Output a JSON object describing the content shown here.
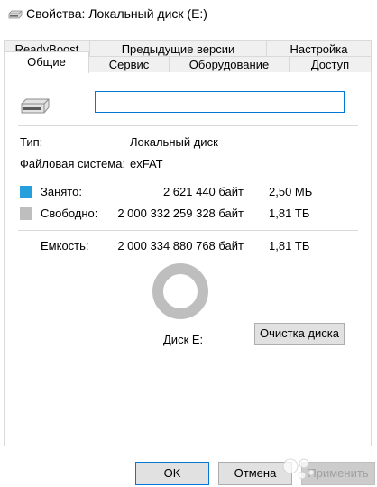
{
  "window": {
    "title": "Свойства: Локальный диск (E:)"
  },
  "tabs": {
    "row1": [
      "ReadyBoost",
      "Предыдущие версии",
      "Настройка"
    ],
    "row2": [
      "Общие",
      "Сервис",
      "Оборудование",
      "Доступ"
    ],
    "active": "Общие"
  },
  "general": {
    "name_value": "",
    "type_label": "Тип:",
    "type_value": "Локальный диск",
    "fs_label": "Файловая система:",
    "fs_value": "exFAT",
    "used_label": "Занято:",
    "used_bytes": "2 621 440 байт",
    "used_size": "2,50 МБ",
    "free_label": "Свободно:",
    "free_bytes": "2 000 332 259 328 байт",
    "free_size": "1,81 ТБ",
    "capacity_label": "Емкость:",
    "capacity_bytes": "2 000 334 880 768 байт",
    "capacity_size": "1,81 ТБ",
    "disk_label": "Диск E:",
    "cleanup_button": "Очистка диска",
    "used_fraction": 1.3e-06
  },
  "colors": {
    "used": "#26a0da",
    "free": "#bebebe",
    "accent": "#0078d7"
  },
  "icons": {
    "title": "drive-icon",
    "drive": "drive-icon"
  },
  "buttons": {
    "ok": "OK",
    "cancel": "Отмена",
    "apply": "Применить"
  },
  "watermark": {
    "text": "Avito"
  }
}
